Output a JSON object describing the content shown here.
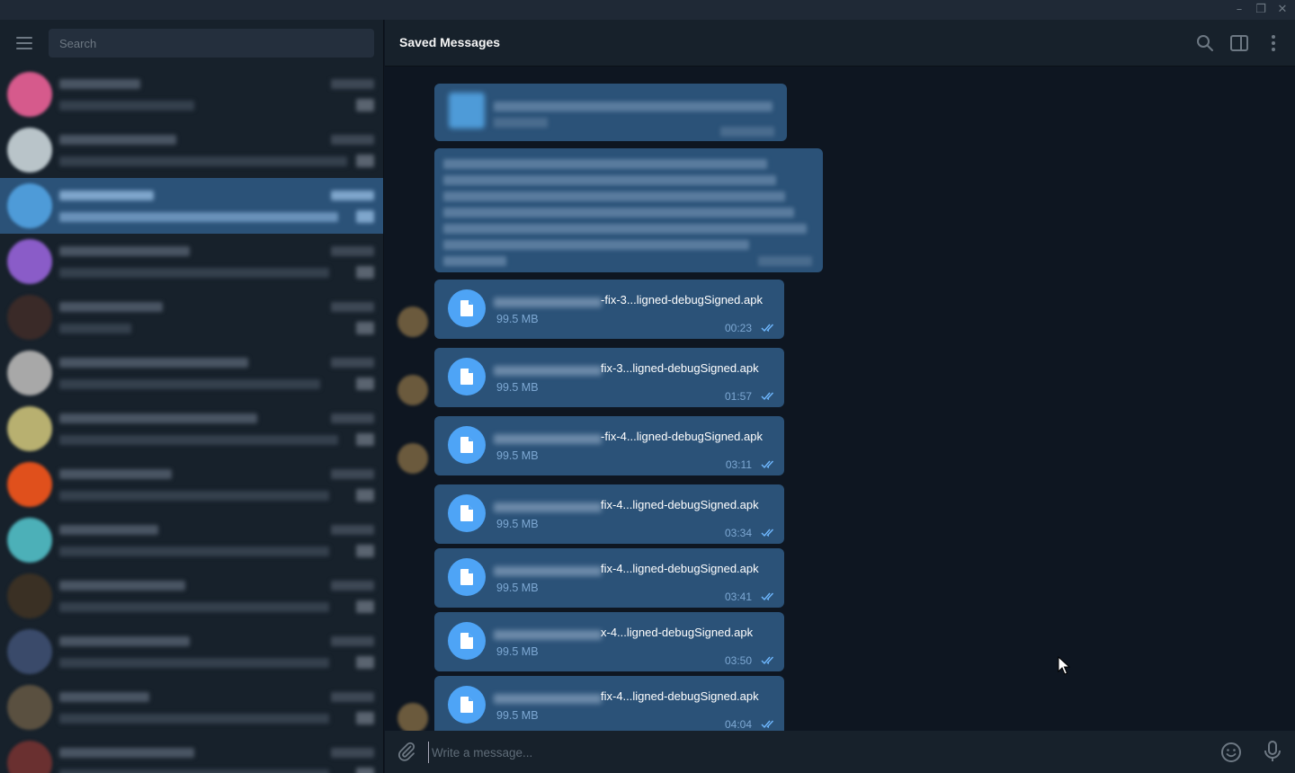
{
  "window": {
    "minimize_glyph": "–",
    "maximize_glyph": "❐",
    "close_glyph": "✕"
  },
  "sidebar": {
    "search_placeholder": "Search",
    "active_index": 2,
    "chats": [
      {
        "avatar_color": "#d65a8c"
      },
      {
        "avatar_color": "#b9c4c9"
      },
      {
        "avatar_color": "#4e9bd8"
      },
      {
        "avatar_color": "#8a5cc8"
      },
      {
        "avatar_color": "#3a2a28"
      },
      {
        "avatar_color": "#a8a8a8"
      },
      {
        "avatar_color": "#b8b070"
      },
      {
        "avatar_color": "#e0501c"
      },
      {
        "avatar_color": "#4cb0b8"
      },
      {
        "avatar_color": "#3a3024"
      },
      {
        "avatar_color": "#3a4a6a"
      },
      {
        "avatar_color": "#5a5040"
      },
      {
        "avatar_color": "#6a3030"
      }
    ]
  },
  "chat": {
    "title": "Saved Messages",
    "composer_placeholder": "Write a message...",
    "files": [
      {
        "name_tail": "-fix-3...ligned-debugSigned.apk",
        "size": "99.5 MB",
        "time": "00:23",
        "has_avatar": true
      },
      {
        "name_tail": "fix-3...ligned-debugSigned.apk",
        "size": "99.5 MB",
        "time": "01:57",
        "has_avatar": true
      },
      {
        "name_tail": "-fix-4...ligned-debugSigned.apk",
        "size": "99.5 MB",
        "time": "03:11",
        "has_avatar": true
      },
      {
        "name_tail": "fix-4...ligned-debugSigned.apk",
        "size": "99.5 MB",
        "time": "03:34",
        "has_avatar": false
      },
      {
        "name_tail": "fix-4...ligned-debugSigned.apk",
        "size": "99.5 MB",
        "time": "03:41",
        "has_avatar": false
      },
      {
        "name_tail": "x-4...ligned-debugSigned.apk",
        "size": "99.5 MB",
        "time": "03:50",
        "has_avatar": false
      },
      {
        "name_tail": "fix-4...ligned-debugSigned.apk",
        "size": "99.5 MB",
        "time": "04:04",
        "has_avatar": true
      }
    ]
  },
  "colors": {
    "accent": "#4ea4f6",
    "bubble": "#2b5278",
    "sidebar_bg": "#17212b",
    "chat_bg": "#0e1621",
    "meta_text": "#7da8d3"
  },
  "icons": [
    "menu-icon",
    "search-icon",
    "sidebar-toggle-icon",
    "more-vertical-icon",
    "file-icon",
    "double-check-icon",
    "attach-icon",
    "emoji-icon",
    "microphone-icon"
  ]
}
